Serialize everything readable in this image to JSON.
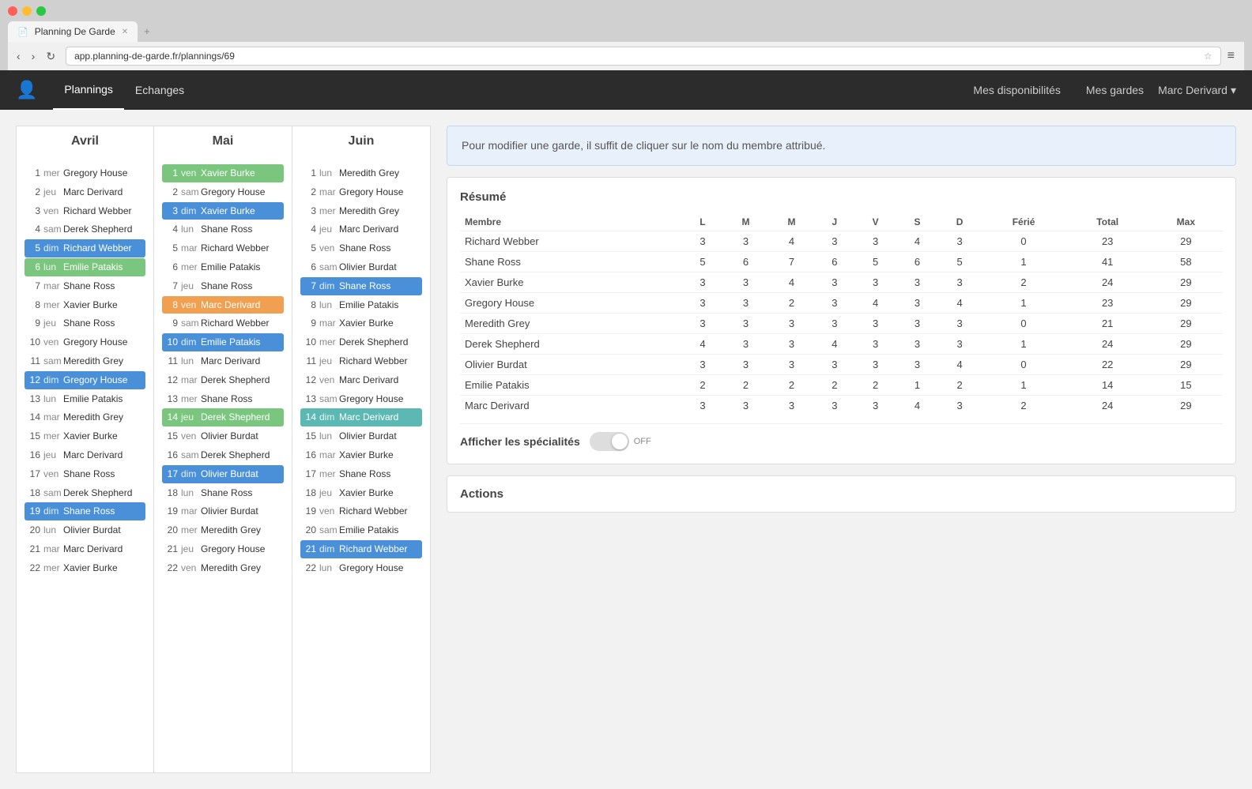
{
  "browser": {
    "tab_label": "Planning De Garde",
    "url": "app.planning-de-garde.fr/plannings/69"
  },
  "navbar": {
    "plannings": "Plannings",
    "echanges": "Echanges",
    "mes_dispo": "Mes disponibilités",
    "mes_gardes": "Mes gardes",
    "user": "Marc Derivard",
    "dropdown_arrow": "▾"
  },
  "info_message": "Pour modifier une garde, il suffit de cliquer sur le nom du membre attribué.",
  "resume": {
    "title": "Résumé",
    "columns": [
      "Membre",
      "L",
      "M",
      "M",
      "J",
      "V",
      "S",
      "D",
      "Férié",
      "Total",
      "Max"
    ],
    "rows": [
      {
        "membre": "Richard Webber",
        "L": 3,
        "M1": 3,
        "M2": 4,
        "J": 3,
        "V": 3,
        "S": 4,
        "D": 3,
        "F": 0,
        "total": 23,
        "max": 29
      },
      {
        "membre": "Shane Ross",
        "L": 5,
        "M1": 6,
        "M2": 7,
        "J": 6,
        "V": 5,
        "S": 6,
        "D": 5,
        "F": 1,
        "total": 41,
        "max": 58
      },
      {
        "membre": "Xavier Burke",
        "L": 3,
        "M1": 3,
        "M2": 4,
        "J": 3,
        "V": 3,
        "S": 3,
        "D": 3,
        "F": 2,
        "total": 24,
        "max": 29
      },
      {
        "membre": "Gregory House",
        "L": 3,
        "M1": 3,
        "M2": 2,
        "J": 3,
        "V": 4,
        "S": 3,
        "D": 4,
        "F": 1,
        "total": 23,
        "max": 29
      },
      {
        "membre": "Meredith Grey",
        "L": 3,
        "M1": 3,
        "M2": 3,
        "J": 3,
        "V": 3,
        "S": 3,
        "D": 3,
        "F": 0,
        "total": 21,
        "max": 29
      },
      {
        "membre": "Derek Shepherd",
        "L": 4,
        "M1": 3,
        "M2": 3,
        "J": 4,
        "V": 3,
        "S": 3,
        "D": 3,
        "F": 1,
        "total": 24,
        "max": 29
      },
      {
        "membre": "Olivier Burdat",
        "L": 3,
        "M1": 3,
        "M2": 3,
        "J": 3,
        "V": 3,
        "S": 3,
        "D": 4,
        "F": 0,
        "total": 22,
        "max": 29
      },
      {
        "membre": "Emilie Patakis",
        "L": 2,
        "M1": 2,
        "M2": 2,
        "J": 2,
        "V": 2,
        "S": 1,
        "D": 2,
        "F": 1,
        "total": 14,
        "max": 15
      },
      {
        "membre": "Marc Derivard",
        "L": 3,
        "M1": 3,
        "M2": 3,
        "J": 3,
        "V": 3,
        "S": 4,
        "D": 3,
        "F": 2,
        "total": 24,
        "max": 29
      }
    ]
  },
  "specialites": {
    "label": "Afficher les spécialités",
    "toggle": "OFF"
  },
  "actions": {
    "title": "Actions"
  },
  "avril": {
    "header": "Avril",
    "rows": [
      {
        "num": 1,
        "day": "mer",
        "name": "Gregory House",
        "highlight": ""
      },
      {
        "num": 2,
        "day": "jeu",
        "name": "Marc Derivard",
        "highlight": ""
      },
      {
        "num": 3,
        "day": "ven",
        "name": "Richard Webber",
        "highlight": ""
      },
      {
        "num": 4,
        "day": "sam",
        "name": "Derek Shepherd",
        "highlight": ""
      },
      {
        "num": 5,
        "day": "dim",
        "name": "Richard Webber",
        "highlight": "blue"
      },
      {
        "num": 6,
        "day": "lun",
        "name": "Emilie Patakis",
        "highlight": "green"
      },
      {
        "num": 7,
        "day": "mar",
        "name": "Shane Ross",
        "highlight": ""
      },
      {
        "num": 8,
        "day": "mer",
        "name": "Xavier Burke",
        "highlight": ""
      },
      {
        "num": 9,
        "day": "jeu",
        "name": "Shane Ross",
        "highlight": ""
      },
      {
        "num": 10,
        "day": "ven",
        "name": "Gregory House",
        "highlight": ""
      },
      {
        "num": 11,
        "day": "sam",
        "name": "Meredith Grey",
        "highlight": ""
      },
      {
        "num": 12,
        "day": "dim",
        "name": "Gregory House",
        "highlight": "blue"
      },
      {
        "num": 13,
        "day": "lun",
        "name": "Emilie Patakis",
        "highlight": ""
      },
      {
        "num": 14,
        "day": "mar",
        "name": "Meredith Grey",
        "highlight": ""
      },
      {
        "num": 15,
        "day": "mer",
        "name": "Xavier Burke",
        "highlight": ""
      },
      {
        "num": 16,
        "day": "jeu",
        "name": "Marc Derivard",
        "highlight": ""
      },
      {
        "num": 17,
        "day": "ven",
        "name": "Shane Ross",
        "highlight": ""
      },
      {
        "num": 18,
        "day": "sam",
        "name": "Derek Shepherd",
        "highlight": ""
      },
      {
        "num": 19,
        "day": "dim",
        "name": "Shane Ross",
        "highlight": "blue"
      },
      {
        "num": 20,
        "day": "lun",
        "name": "Olivier Burdat",
        "highlight": ""
      },
      {
        "num": 21,
        "day": "mar",
        "name": "Marc Derivard",
        "highlight": ""
      },
      {
        "num": 22,
        "day": "mer",
        "name": "Xavier Burke",
        "highlight": ""
      }
    ]
  },
  "mai": {
    "header": "Mai",
    "rows": [
      {
        "num": 1,
        "day": "ven",
        "name": "Xavier Burke",
        "highlight": "green"
      },
      {
        "num": 2,
        "day": "sam",
        "name": "Gregory House",
        "highlight": ""
      },
      {
        "num": 3,
        "day": "dim",
        "name": "Xavier Burke",
        "highlight": "blue"
      },
      {
        "num": 4,
        "day": "lun",
        "name": "Shane Ross",
        "highlight": ""
      },
      {
        "num": 5,
        "day": "mar",
        "name": "Richard Webber",
        "highlight": ""
      },
      {
        "num": 6,
        "day": "mer",
        "name": "Emilie Patakis",
        "highlight": ""
      },
      {
        "num": 7,
        "day": "jeu",
        "name": "Shane Ross",
        "highlight": ""
      },
      {
        "num": 8,
        "day": "ven",
        "name": "Marc Derivard",
        "highlight": "orange"
      },
      {
        "num": 9,
        "day": "sam",
        "name": "Richard Webber",
        "highlight": ""
      },
      {
        "num": 10,
        "day": "dim",
        "name": "Emilie Patakis",
        "highlight": "blue"
      },
      {
        "num": 11,
        "day": "lun",
        "name": "Marc Derivard",
        "highlight": ""
      },
      {
        "num": 12,
        "day": "mar",
        "name": "Derek Shepherd",
        "highlight": ""
      },
      {
        "num": 13,
        "day": "mer",
        "name": "Shane Ross",
        "highlight": ""
      },
      {
        "num": 14,
        "day": "jeu",
        "name": "Derek Shepherd",
        "highlight": "green"
      },
      {
        "num": 15,
        "day": "ven",
        "name": "Olivier Burdat",
        "highlight": ""
      },
      {
        "num": 16,
        "day": "sam",
        "name": "Derek Shepherd",
        "highlight": ""
      },
      {
        "num": 17,
        "day": "dim",
        "name": "Olivier Burdat",
        "highlight": "blue"
      },
      {
        "num": 18,
        "day": "lun",
        "name": "Shane Ross",
        "highlight": ""
      },
      {
        "num": 19,
        "day": "mar",
        "name": "Olivier Burdat",
        "highlight": ""
      },
      {
        "num": 20,
        "day": "mer",
        "name": "Meredith Grey",
        "highlight": ""
      },
      {
        "num": 21,
        "day": "jeu",
        "name": "Gregory House",
        "highlight": ""
      },
      {
        "num": 22,
        "day": "ven",
        "name": "Meredith Grey",
        "highlight": ""
      }
    ]
  },
  "juin": {
    "header": "Juin",
    "rows": [
      {
        "num": 1,
        "day": "lun",
        "name": "Meredith Grey",
        "highlight": ""
      },
      {
        "num": 2,
        "day": "mar",
        "name": "Gregory House",
        "highlight": ""
      },
      {
        "num": 3,
        "day": "mer",
        "name": "Meredith Grey",
        "highlight": ""
      },
      {
        "num": 4,
        "day": "jeu",
        "name": "Marc Derivard",
        "highlight": ""
      },
      {
        "num": 5,
        "day": "ven",
        "name": "Shane Ross",
        "highlight": ""
      },
      {
        "num": 6,
        "day": "sam",
        "name": "Olivier Burdat",
        "highlight": ""
      },
      {
        "num": 7,
        "day": "dim",
        "name": "Shane Ross",
        "highlight": "blue"
      },
      {
        "num": 8,
        "day": "lun",
        "name": "Emilie Patakis",
        "highlight": ""
      },
      {
        "num": 9,
        "day": "mar",
        "name": "Xavier Burke",
        "highlight": ""
      },
      {
        "num": 10,
        "day": "mer",
        "name": "Derek Shepherd",
        "highlight": ""
      },
      {
        "num": 11,
        "day": "jeu",
        "name": "Richard Webber",
        "highlight": ""
      },
      {
        "num": 12,
        "day": "ven",
        "name": "Marc Derivard",
        "highlight": ""
      },
      {
        "num": 13,
        "day": "sam",
        "name": "Gregory House",
        "highlight": ""
      },
      {
        "num": 14,
        "day": "dim",
        "name": "Marc Derivard",
        "highlight": "teal"
      },
      {
        "num": 15,
        "day": "lun",
        "name": "Olivier Burdat",
        "highlight": ""
      },
      {
        "num": 16,
        "day": "mar",
        "name": "Xavier Burke",
        "highlight": ""
      },
      {
        "num": 17,
        "day": "mer",
        "name": "Shane Ross",
        "highlight": ""
      },
      {
        "num": 18,
        "day": "jeu",
        "name": "Xavier Burke",
        "highlight": ""
      },
      {
        "num": 19,
        "day": "ven",
        "name": "Richard Webber",
        "highlight": ""
      },
      {
        "num": 20,
        "day": "sam",
        "name": "Emilie Patakis",
        "highlight": ""
      },
      {
        "num": 21,
        "day": "dim",
        "name": "Richard Webber",
        "highlight": "blue"
      },
      {
        "num": 22,
        "day": "lun",
        "name": "Gregory House",
        "highlight": ""
      }
    ]
  }
}
